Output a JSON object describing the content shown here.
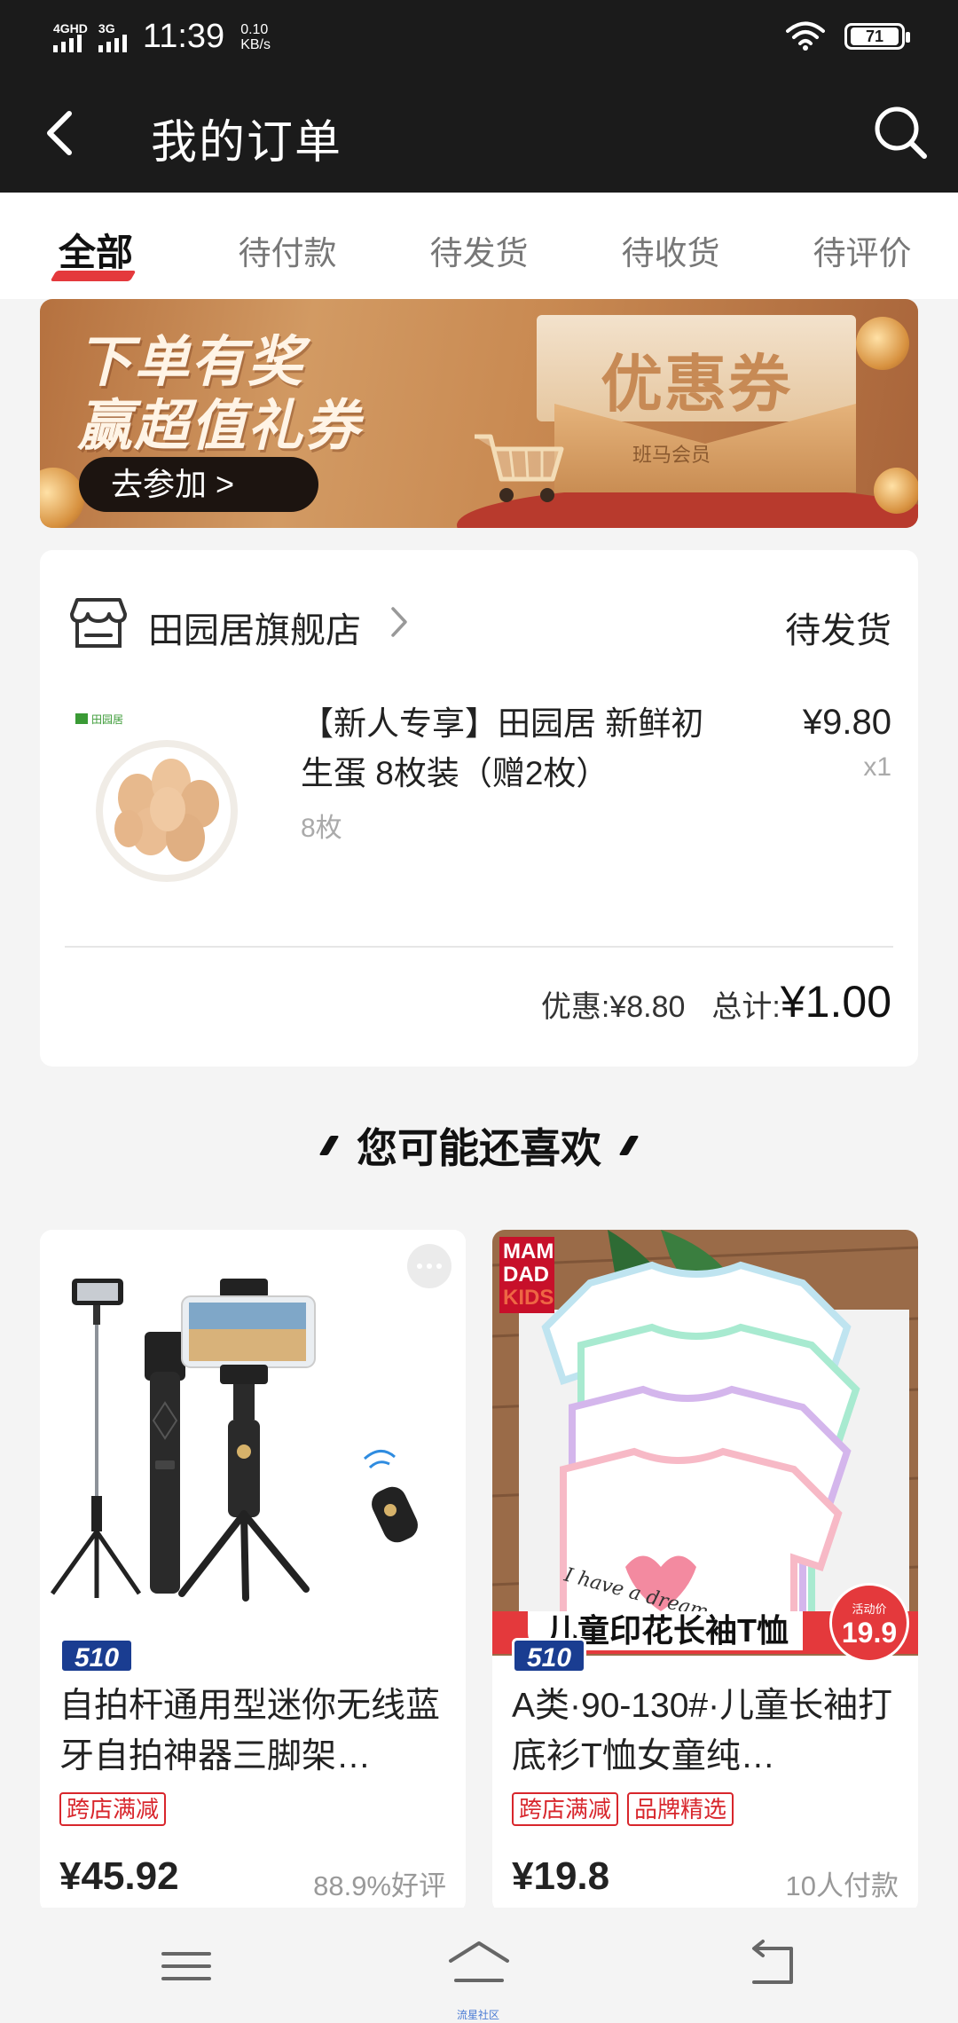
{
  "status_bar": {
    "signal1_label": "4GHD",
    "signal2_label": "3G",
    "time": "11:39",
    "speed_value": "0.10",
    "speed_unit": "KB/s",
    "battery": "71"
  },
  "header": {
    "title": "我的订单"
  },
  "tabs": [
    {
      "label": "全部",
      "active": true
    },
    {
      "label": "待付款"
    },
    {
      "label": "待发货"
    },
    {
      "label": "待收货"
    },
    {
      "label": "待评价"
    }
  ],
  "banner": {
    "line1": "下单有奖",
    "line2": "赢超值礼券",
    "button": "去参加 >",
    "coupon_text": "优惠券",
    "envelope_brand": "班马会员"
  },
  "order": {
    "store_name": "田园居旗舰店",
    "status": "待发货",
    "product_title": "【新人专享】田园居 新鲜初生蛋 8枚装（赠2枚）",
    "spec": "8枚",
    "price": "¥9.80",
    "quantity": "x1",
    "discount": "优惠:¥8.80",
    "total_label": "总计:",
    "total_value": "¥1.00",
    "thumb_brand": "田园居"
  },
  "recommend": {
    "title": "您可能还喜欢",
    "items": [
      {
        "badge": "510",
        "title": "自拍杆通用型迷你无线蓝牙自拍神器三脚架…",
        "tags": [
          "跨店满减"
        ],
        "price": "¥45.92",
        "meta": "88.9%好评"
      },
      {
        "badge": "510",
        "title": "A类·90-130#·儿童长袖打底衫T恤女童纯…",
        "tags": [
          "跨店满减",
          "品牌精选"
        ],
        "price": "¥19.8",
        "meta": "10人付款",
        "image_caption": "儿童印花长袖T恤",
        "promo_small": "活动价",
        "promo_price": "19.9",
        "logo_lines": [
          "MAM",
          "DAD",
          "KIDS"
        ],
        "shirt_text": "I have a dream"
      }
    ]
  },
  "navbar": {
    "home_label": "流星社区"
  },
  "colors": {
    "accent": "#e4393c",
    "header_bg": "#1b1b1b",
    "badge_blue": "#1a3d91"
  }
}
